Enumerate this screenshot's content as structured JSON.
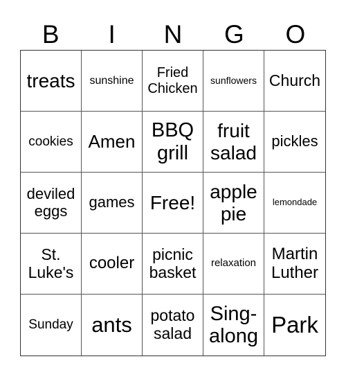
{
  "header": {
    "letters": [
      "B",
      "I",
      "N",
      "G",
      "O"
    ]
  },
  "cells": [
    {
      "text": "treats",
      "size": 28
    },
    {
      "text": "sunshine",
      "size": 16
    },
    {
      "text": "Fried Chicken",
      "size": 20
    },
    {
      "text": "sunflowers",
      "size": 14
    },
    {
      "text": "Church",
      "size": 23
    },
    {
      "text": "cookies",
      "size": 19
    },
    {
      "text": "Amen",
      "size": 26
    },
    {
      "text": "BBQ grill",
      "size": 29
    },
    {
      "text": "fruit salad",
      "size": 28
    },
    {
      "text": "pickles",
      "size": 22
    },
    {
      "text": "deviled eggs",
      "size": 22
    },
    {
      "text": "games",
      "size": 22
    },
    {
      "text": "Free!",
      "size": 28
    },
    {
      "text": "apple pie",
      "size": 28
    },
    {
      "text": "lemondade",
      "size": 13
    },
    {
      "text": "St. Luke's",
      "size": 23
    },
    {
      "text": "cooler",
      "size": 24
    },
    {
      "text": "picnic basket",
      "size": 23
    },
    {
      "text": "relaxation",
      "size": 15
    },
    {
      "text": "Martin Luther",
      "size": 24
    },
    {
      "text": "Sunday",
      "size": 19
    },
    {
      "text": "ants",
      "size": 31
    },
    {
      "text": "potato salad",
      "size": 23
    },
    {
      "text": "Sing-along",
      "size": 29
    },
    {
      "text": "Park",
      "size": 33
    }
  ]
}
